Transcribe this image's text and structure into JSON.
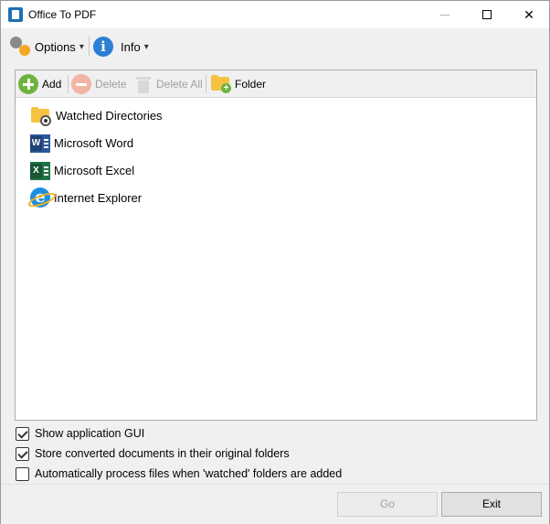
{
  "window": {
    "title": "Office To PDF"
  },
  "toolbar": {
    "options_label": "Options",
    "info_label": "Info"
  },
  "list_toolbar": {
    "add_label": "Add",
    "delete_label": "Delete",
    "delete_all_label": "Delete All",
    "folder_label": "Folder"
  },
  "tree": {
    "items": [
      {
        "label": "Watched Directories"
      },
      {
        "label": "Microsoft Word"
      },
      {
        "label": "Microsoft Excel"
      },
      {
        "label": "Internet Explorer"
      }
    ]
  },
  "options": [
    {
      "label": "Show application GUI",
      "checked": true
    },
    {
      "label": "Store converted documents in their original folders",
      "checked": true
    },
    {
      "label": "Automatically process files when 'watched' folders are added",
      "checked": false
    }
  ],
  "footer": {
    "go_label": "Go",
    "exit_label": "Exit"
  }
}
